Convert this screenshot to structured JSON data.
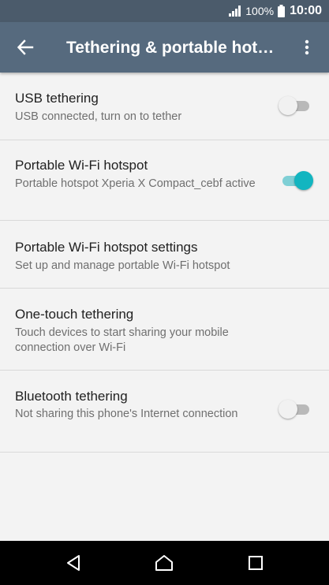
{
  "status_bar": {
    "battery_percent": "100%",
    "time": "10:00",
    "icons": [
      "signal-icon",
      "battery-icon"
    ]
  },
  "app_bar": {
    "title": "Tethering & portable hot…",
    "back_icon": "back-arrow-icon",
    "menu_icon": "overflow-menu-icon"
  },
  "settings": {
    "items": [
      {
        "title": "USB tethering",
        "subtitle": "USB connected, turn on to tether",
        "toggle": "off"
      },
      {
        "title": "Portable Wi-Fi hotspot",
        "subtitle": "Portable hotspot Xperia X Compact_cebf active",
        "toggle": "on"
      },
      {
        "title": "Portable Wi-Fi hotspot settings",
        "subtitle": "Set up and manage portable Wi-Fi hotspot"
      },
      {
        "title": "One-touch tethering",
        "subtitle": "Touch devices to start sharing your mobile connection over Wi-Fi"
      },
      {
        "title": "Bluetooth tethering",
        "subtitle": "Not sharing this phone's Internet connection",
        "toggle": "off"
      }
    ]
  },
  "nav_bar": {
    "icons": [
      "back-triangle-icon",
      "home-icon",
      "recents-icon"
    ]
  },
  "colors": {
    "status_bar": "#4b5b6b",
    "app_bar": "#566a7e",
    "background": "#f3f3f3",
    "toggle_on": "#12b5c0",
    "toggle_off": "#b9b9b9"
  }
}
